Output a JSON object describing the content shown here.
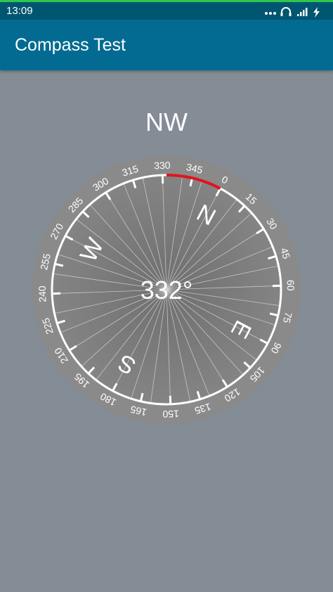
{
  "status_bar": {
    "time": "13:09",
    "icons": [
      "more-dots-icon",
      "headphones-icon",
      "signal-icon",
      "charging-icon"
    ]
  },
  "app_bar": {
    "title": "Compass Test"
  },
  "compass": {
    "direction": "NW",
    "heading_value": 332,
    "heading_label": "332°",
    "tick_labels": [
      "0",
      "15",
      "30",
      "45",
      "60",
      "75",
      "90",
      "105",
      "120",
      "135",
      "150",
      "165",
      "180",
      "195",
      "210",
      "225",
      "240",
      "255",
      "270",
      "285",
      "300",
      "315",
      "330",
      "345"
    ],
    "cardinals": [
      "N",
      "E",
      "S",
      "W"
    ],
    "colors": {
      "face": "#7b7b7b",
      "ring": "#8a8a8a",
      "ring_line": "#ffffff",
      "heading_arc": "#e0141e",
      "background": "#848c96",
      "app_bar": "#036b91",
      "status_bar": "#005670"
    }
  }
}
